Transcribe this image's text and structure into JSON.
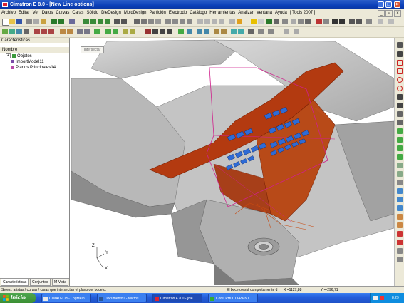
{
  "window": {
    "title": "Cimatron E 8.0 - [New Line options]"
  },
  "menu": {
    "items": [
      "Archivo",
      "Editar",
      "Ver",
      "Datos",
      "Curvas",
      "Caras",
      "Sólido",
      "DieDesign",
      "MoldDesign",
      "Partición",
      "Electrodo",
      "Catálogo",
      "Herramientas",
      "Analizar",
      "Ventana",
      "Ayuda",
      "[ Tools 2007 ]"
    ]
  },
  "left_panel": {
    "header": "Características",
    "column_header": "Nombre",
    "tree": [
      {
        "label": "Objetos",
        "icon": "objects-icon"
      },
      {
        "label": "ImportModel11",
        "icon": "import-model-icon"
      },
      {
        "label": "Planos Principales14",
        "icon": "planes-icon"
      }
    ],
    "tabs": [
      "Características",
      "Conjuntos",
      "M-Vista"
    ]
  },
  "viewport": {
    "intersect_button": "Intersectar",
    "axis_labels": {
      "z": "Z",
      "y": "Y",
      "x": "X"
    }
  },
  "status": {
    "hint": "Seles.: aristas / curvas / caras que intersectan el plano del boceto.",
    "message": "El boceto está completamente d",
    "x_readout": "X =1127,88",
    "y_readout": "Y =-296,71"
  },
  "taskbar": {
    "start_label": "Inicio",
    "tasks": [
      {
        "label": "CIMATECH - LogMeIn...",
        "icon": "logmein-icon"
      },
      {
        "label": "Documento1 - Micros...",
        "icon": "word-icon"
      },
      {
        "label": "Cimatron E 8.0 - [Ne...",
        "icon": "cimatron-icon"
      },
      {
        "label": "Corel PHOTO-PAINT ...",
        "icon": "corel-icon"
      }
    ],
    "clock": "8:29"
  },
  "colors": {
    "titlebar": "#0a3fb8",
    "model_grey": "#b9b9b9",
    "highlight_orange": "#b33a10",
    "sketch_magenta": "#d0208c",
    "components_blue": "#2e6bd6"
  }
}
